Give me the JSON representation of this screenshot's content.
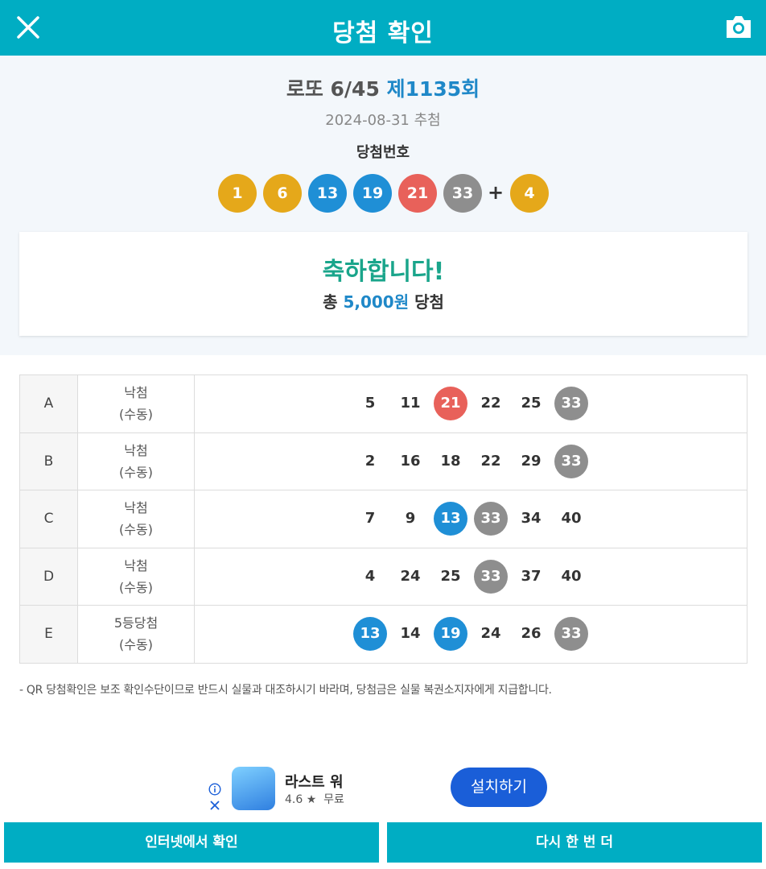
{
  "header": {
    "title": "당첨 확인",
    "close_icon": "close-icon",
    "camera_icon": "camera-icon",
    "color": "#00adc3"
  },
  "summary": {
    "round_prefix": "로또 6/45",
    "round": "제1135회",
    "date": "2024-08-31 추첨",
    "label": "당첨번호",
    "numbers": [
      "1",
      "6",
      "13",
      "19",
      "21",
      "33"
    ],
    "plus": "+",
    "bonus": "4"
  },
  "result": {
    "congrats": "축하합니다!",
    "total_prefix": "총",
    "total_amount": "5,000원",
    "total_suffix": "당첨"
  },
  "games": [
    {
      "label": "A",
      "result": "낙첨",
      "mode": "(수동)",
      "numbers": [
        "5",
        "11",
        "21",
        "22",
        "25",
        "33"
      ],
      "hits": [
        false,
        false,
        true,
        false,
        false,
        true
      ]
    },
    {
      "label": "B",
      "result": "낙첨",
      "mode": "(수동)",
      "numbers": [
        "2",
        "16",
        "18",
        "22",
        "29",
        "33"
      ],
      "hits": [
        false,
        false,
        false,
        false,
        false,
        true
      ]
    },
    {
      "label": "C",
      "result": "낙첨",
      "mode": "(수동)",
      "numbers": [
        "7",
        "9",
        "13",
        "33",
        "34",
        "40"
      ],
      "hits": [
        false,
        false,
        true,
        true,
        false,
        false
      ]
    },
    {
      "label": "D",
      "result": "낙첨",
      "mode": "(수동)",
      "numbers": [
        "4",
        "24",
        "25",
        "33",
        "37",
        "40"
      ],
      "hits": [
        false,
        false,
        false,
        true,
        false,
        false
      ]
    },
    {
      "label": "E",
      "result": "5등당첨",
      "mode": "(수동)",
      "numbers": [
        "13",
        "14",
        "19",
        "24",
        "26",
        "33"
      ],
      "hits": [
        true,
        false,
        true,
        false,
        false,
        true
      ]
    }
  ],
  "ball_colors": {
    "yellow": "#e5a81a",
    "blue": "#1f8fd6",
    "red": "#e8615a",
    "gray": "#8e8e8e",
    "green": "#6bbd4c"
  },
  "note": "- QR 당첨확인은 보조 확인수단이므로 반드시 실물과 대조하시기 바라며, 당첨금은 실물 복권소지자에게 지급합니다.",
  "ad": {
    "app_name": "라스트 워",
    "rating": "4.6 ★",
    "price": "무료",
    "install_label": "설치하기",
    "info_icon": "info-icon",
    "close_icon": "close-icon"
  },
  "buttons": {
    "web_check": "인터넷에서 확인",
    "again": "다시 한 번 더"
  }
}
